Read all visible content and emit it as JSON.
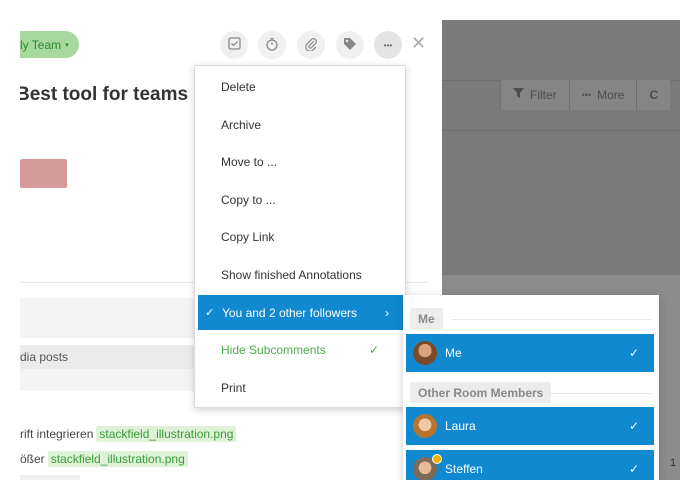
{
  "header": {
    "team_label": "ly Team",
    "page_title": "Best tool for teams"
  },
  "backdrop": {
    "filter_label": "Filter",
    "more_label": "More",
    "cut_label": "C",
    "count": "1"
  },
  "content": {
    "posts_text": "dia posts",
    "attachments": [
      {
        "prefix": "rift integrieren",
        "file": "stackfield_illustration.png"
      },
      {
        "prefix": "ößer",
        "file": "stackfield_illustration.png"
      }
    ]
  },
  "menu": {
    "items": [
      {
        "label": "Delete"
      },
      {
        "label": "Archive"
      },
      {
        "label": "Move to ..."
      },
      {
        "label": "Copy to ..."
      },
      {
        "label": "Copy Link"
      },
      {
        "label": "Show finished Annotations"
      },
      {
        "label": "You and 2 other followers"
      },
      {
        "label": "Hide Subcomments"
      },
      {
        "label": "Print"
      }
    ]
  },
  "submenu": {
    "section_me": "Me",
    "section_others": "Other Room Members",
    "people": [
      {
        "name": "Me",
        "checked": true
      },
      {
        "name": "Laura",
        "checked": true
      },
      {
        "name": "Steffen",
        "checked": true
      }
    ]
  },
  "icons": {
    "check": "✓",
    "chevron": "›",
    "more": "•••",
    "close": "✕",
    "caret": "▾"
  },
  "colors": {
    "accent": "#1189d1",
    "green": "#4cae4c",
    "badge_bg": "#a7d89e"
  }
}
